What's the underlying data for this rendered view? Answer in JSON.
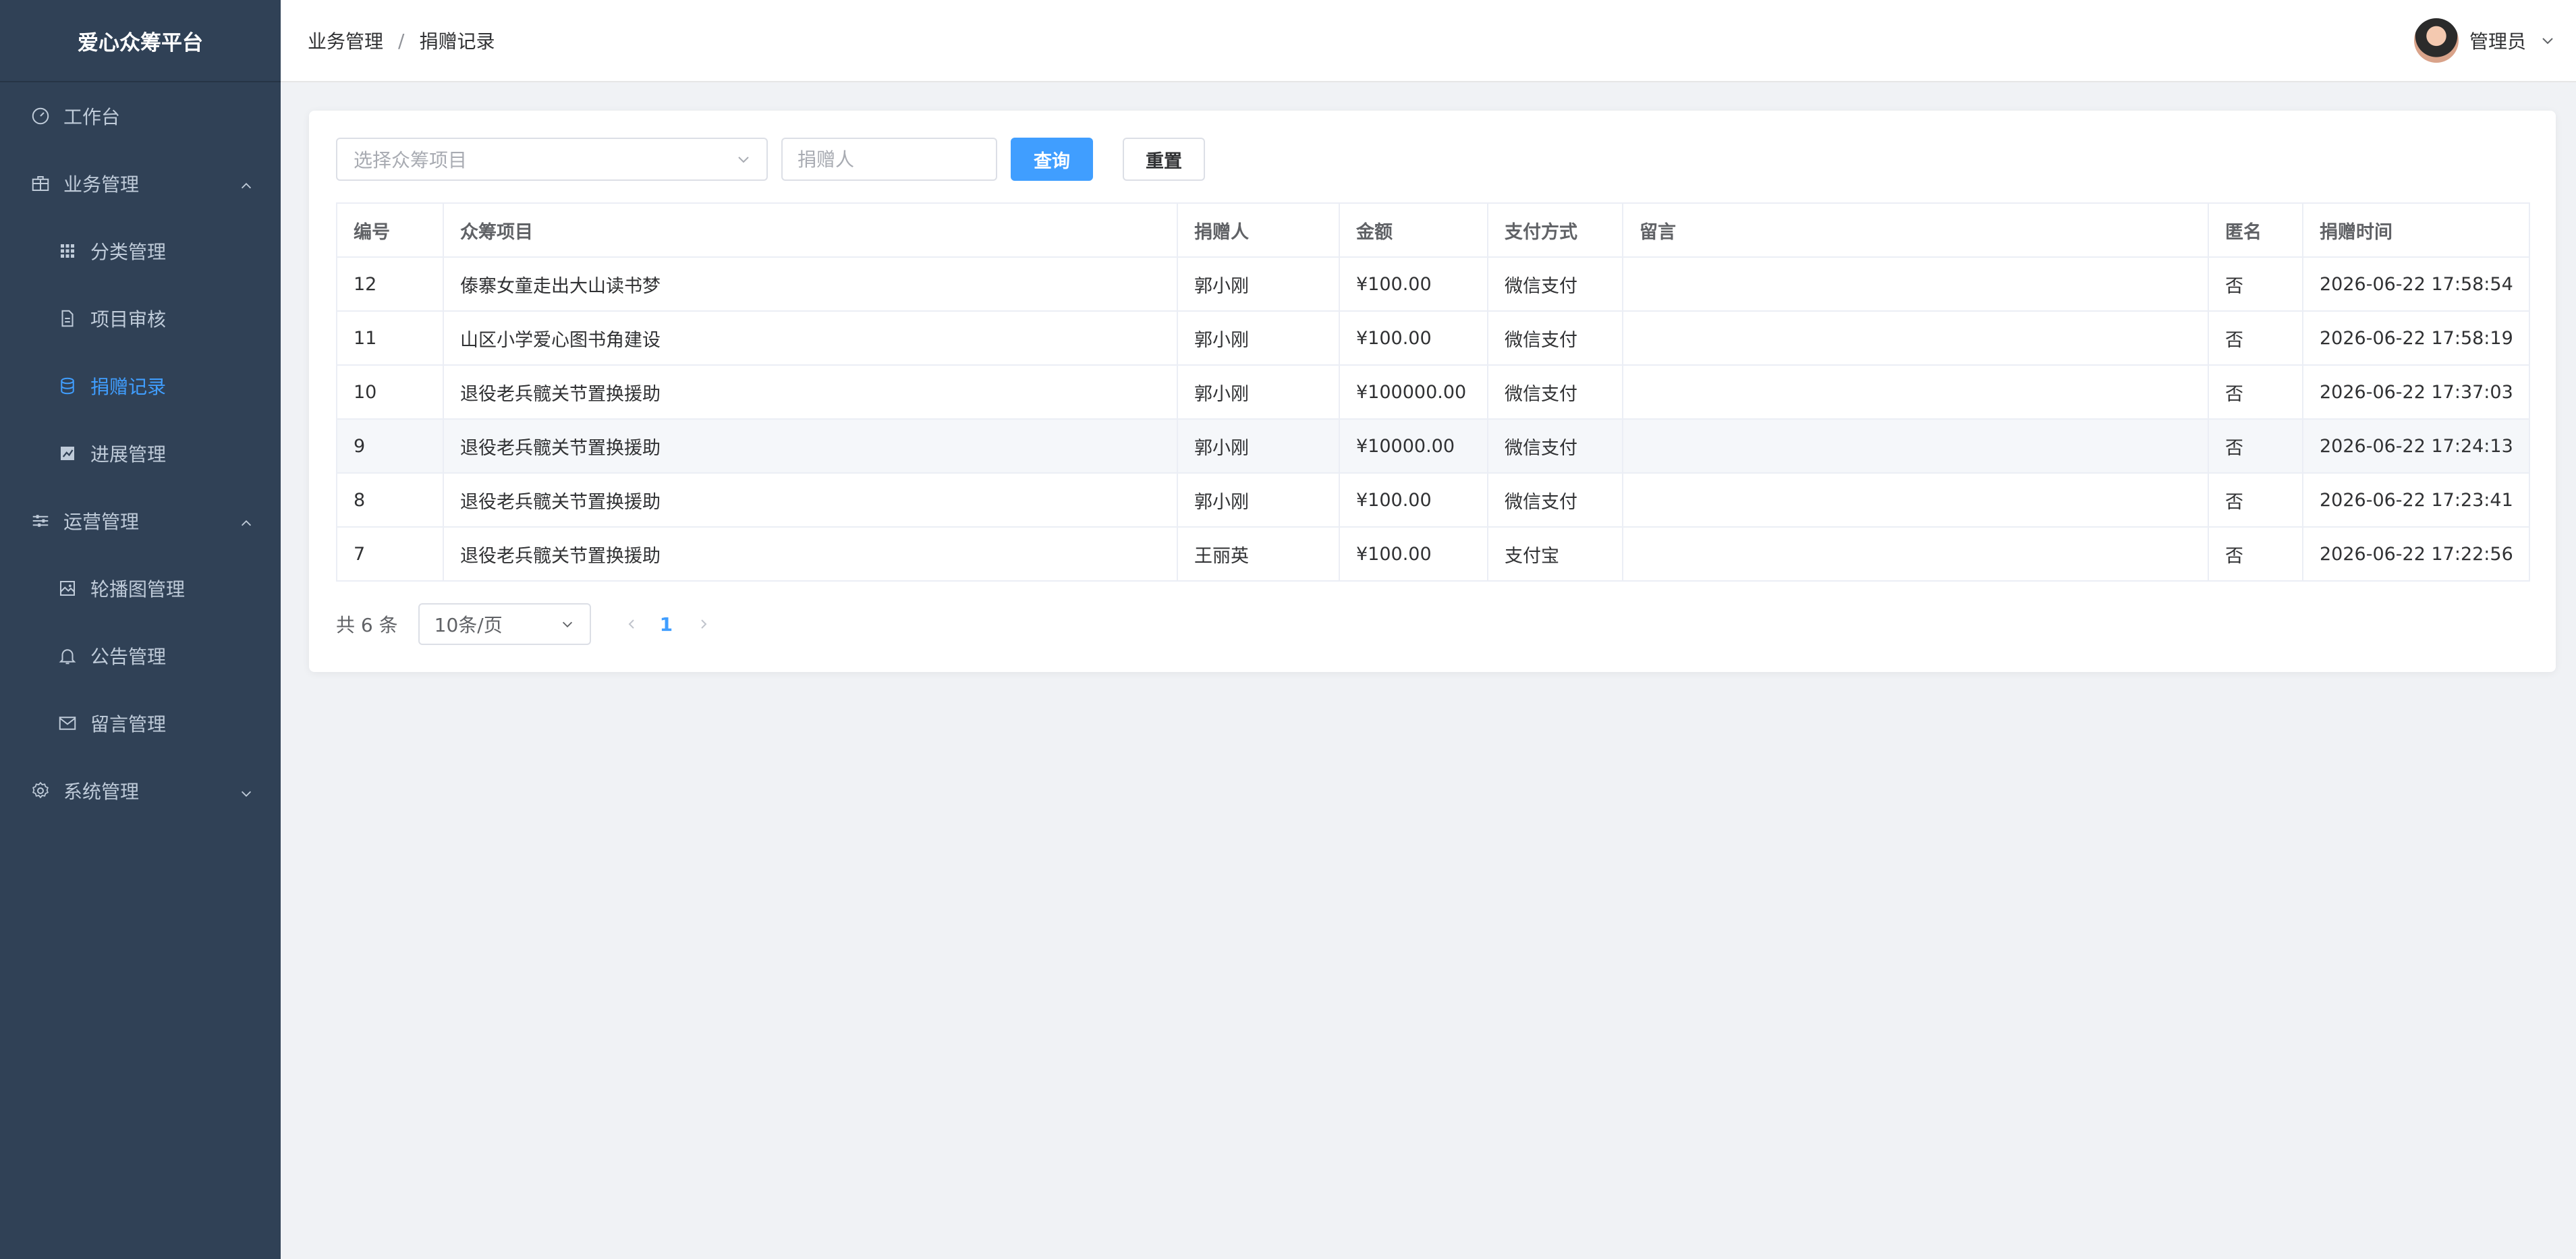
{
  "app": {
    "title": "爱心众筹平台"
  },
  "sidebar": {
    "items": [
      {
        "label": "工作台",
        "icon": "dashboard-icon",
        "level": "top"
      },
      {
        "label": "业务管理",
        "icon": "briefcase-icon",
        "level": "top",
        "expanded": true
      },
      {
        "label": "分类管理",
        "icon": "grid-icon",
        "level": "sub"
      },
      {
        "label": "项目审核",
        "icon": "document-icon",
        "level": "sub"
      },
      {
        "label": "捐赠记录",
        "icon": "database-icon",
        "level": "sub",
        "active": true
      },
      {
        "label": "进展管理",
        "icon": "chart-icon",
        "level": "sub"
      },
      {
        "label": "运营管理",
        "icon": "sliders-icon",
        "level": "top",
        "expanded": true
      },
      {
        "label": "轮播图管理",
        "icon": "picture-icon",
        "level": "sub"
      },
      {
        "label": "公告管理",
        "icon": "bell-icon",
        "level": "sub"
      },
      {
        "label": "留言管理",
        "icon": "message-icon",
        "level": "sub"
      },
      {
        "label": "系统管理",
        "icon": "gear-icon",
        "level": "top",
        "expanded": false
      }
    ]
  },
  "header": {
    "breadcrumb": [
      "业务管理",
      "捐赠记录"
    ],
    "separator": "/",
    "user": "管理员"
  },
  "filters": {
    "project_placeholder": "选择众筹项目",
    "donor_placeholder": "捐赠人",
    "query_label": "查询",
    "reset_label": "重置"
  },
  "table": {
    "columns": [
      "编号",
      "众筹项目",
      "捐赠人",
      "金额",
      "支付方式",
      "留言",
      "匿名",
      "捐赠时间"
    ],
    "rows": [
      [
        "12",
        "傣寨女童走出大山读书梦",
        "郭小刚",
        "¥100.00",
        "微信支付",
        "",
        "否",
        "2026-06-22 17:58:54"
      ],
      [
        "11",
        "山区小学爱心图书角建设",
        "郭小刚",
        "¥100.00",
        "微信支付",
        "",
        "否",
        "2026-06-22 17:58:19"
      ],
      [
        "10",
        "退役老兵髋关节置换援助",
        "郭小刚",
        "¥100000.00",
        "微信支付",
        "",
        "否",
        "2026-06-22 17:37:03"
      ],
      [
        "9",
        "退役老兵髋关节置换援助",
        "郭小刚",
        "¥10000.00",
        "微信支付",
        "",
        "否",
        "2026-06-22 17:24:13"
      ],
      [
        "8",
        "退役老兵髋关节置换援助",
        "郭小刚",
        "¥100.00",
        "微信支付",
        "",
        "否",
        "2026-06-22 17:23:41"
      ],
      [
        "7",
        "退役老兵髋关节置换援助",
        "王丽英",
        "¥100.00",
        "支付宝",
        "",
        "否",
        "2026-06-22 17:22:56"
      ]
    ]
  },
  "pagination": {
    "total_text": "共 6 条",
    "page_size": "10条/页",
    "current_page": "1"
  },
  "colors": {
    "sidebar_bg": "#304156",
    "accent": "#409eff"
  }
}
